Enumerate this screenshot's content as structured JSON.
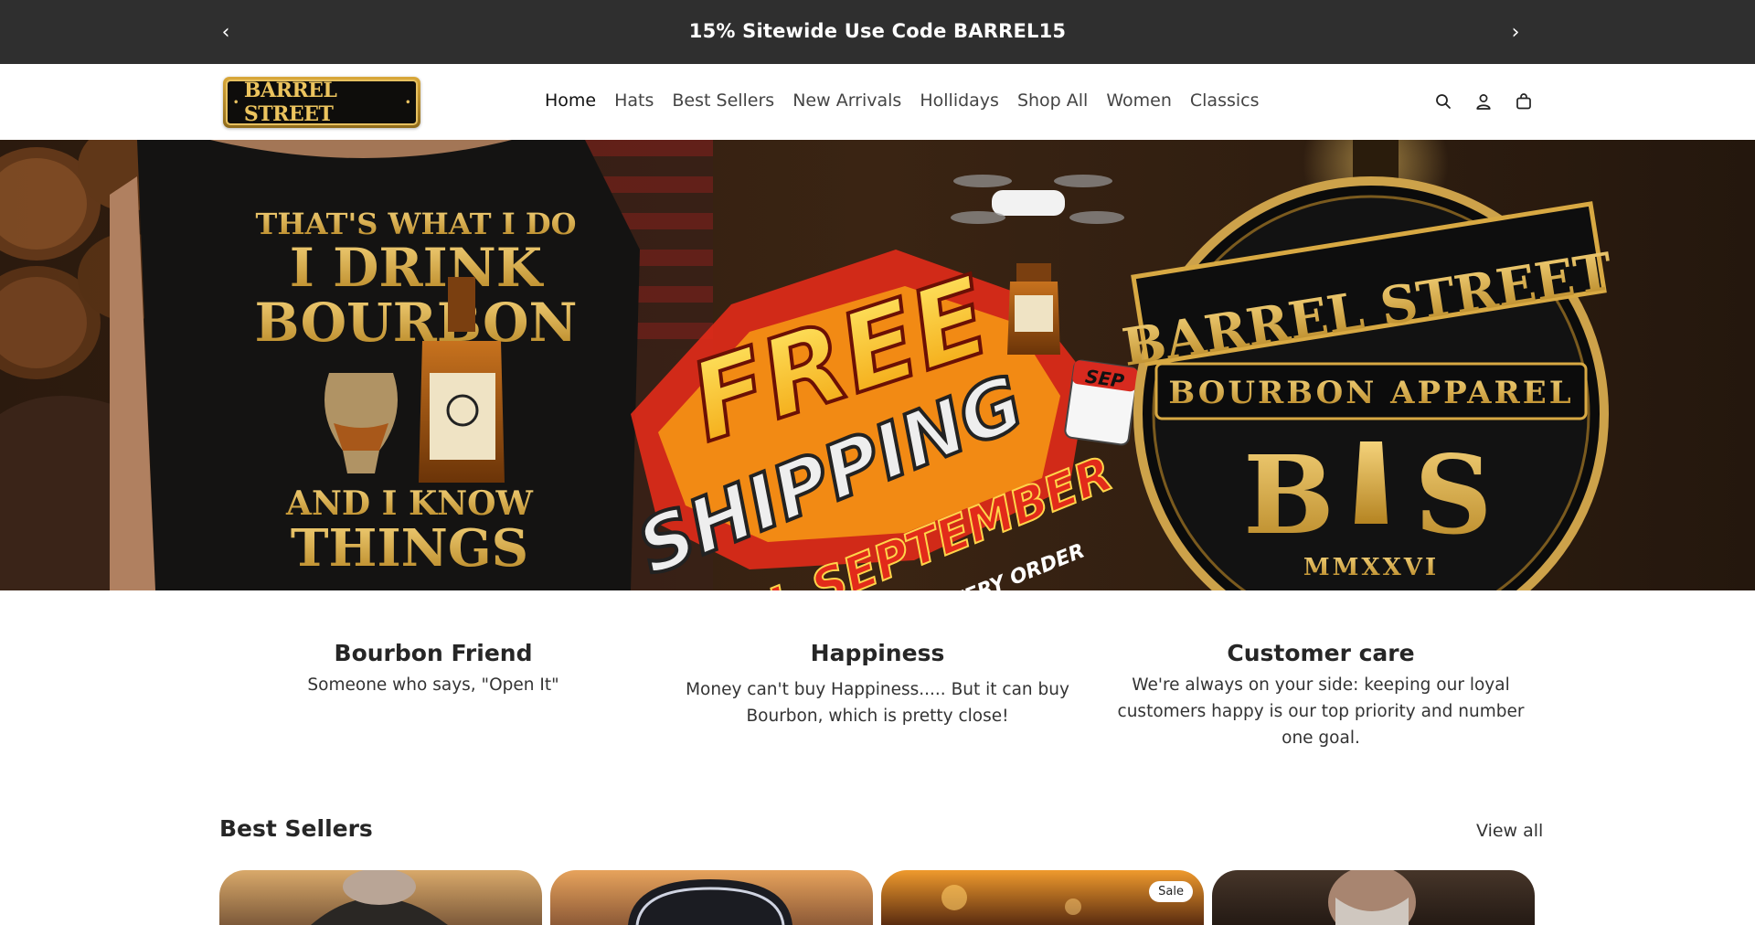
{
  "announcement": {
    "text": "15% Sitewide Use Code BARREL15",
    "prev": "‹",
    "next": "›"
  },
  "logo": {
    "text": "BARREL STREET",
    "dot": "•"
  },
  "nav": [
    "Home",
    "Hats",
    "Best Sellers",
    "New Arrivals",
    "Hollidays",
    "Shop All",
    "Women",
    "Classics"
  ],
  "header_icons": [
    "search-icon",
    "account-icon",
    "cart-icon"
  ],
  "hero": {
    "shirt": {
      "line1": "THAT'S WHAT I DO",
      "line2": "I DRINK",
      "line3": "BOURBON",
      "line4": "AND I KNOW",
      "line5": "THINGS"
    },
    "promo": {
      "line1": "FREE",
      "line2": "SHIPPING",
      "line3": "ALL SEPTEMBER",
      "line4": "NO MINIMUM • EVERY ORDER",
      "month": "SEP"
    },
    "badge": {
      "line1": "BARREL STREET",
      "line2": "BOURBON APPAREL",
      "monogram_b": "B",
      "monogram_s": "S",
      "year": "MMXXVI"
    }
  },
  "features": [
    {
      "title": "Bourbon Friend",
      "text": "Someone who says, \"Open It\""
    },
    {
      "title": "Happiness",
      "text": "Money can't buy Happiness..... But it can buy Bourbon, which is pretty close!"
    },
    {
      "title": "Customer care",
      "text": "We're always on your side: keeping our loyal customers happy is our top priority and number one goal."
    }
  ],
  "best_sellers": {
    "title": "Best Sellers",
    "view_all": "View all",
    "sale_badge": "Sale"
  },
  "colors": {
    "announcement_bg": "#2f2f2f",
    "gold": "#d8a943",
    "promo_red": "#e22b1a"
  }
}
